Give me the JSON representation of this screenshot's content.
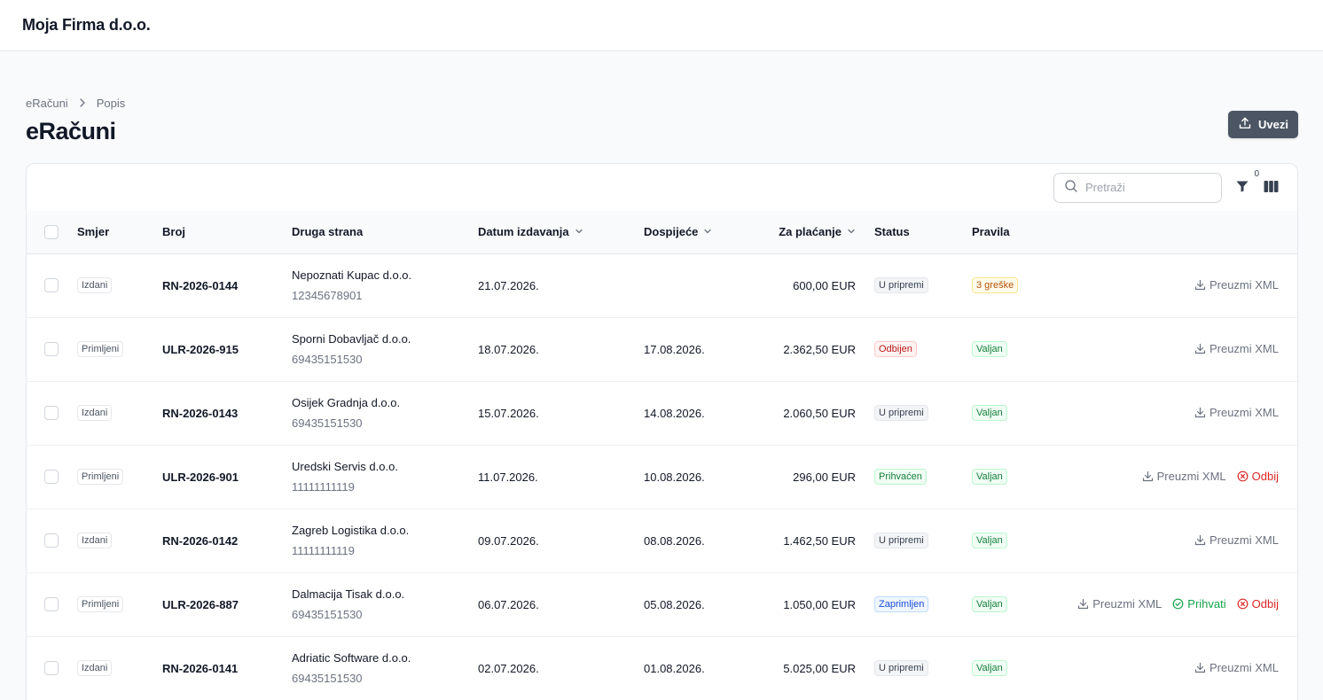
{
  "app": {
    "brand": "Moja Firma d.o.o."
  },
  "breadcrumb": {
    "root": "eRačuni",
    "current": "Popis"
  },
  "page": {
    "title": "eRačuni",
    "import_label": "Uvezi"
  },
  "toolbar": {
    "search_placeholder": "Pretraži",
    "filter_count": "0"
  },
  "table": {
    "headers": {
      "direction": "Smjer",
      "number": "Broj",
      "party": "Druga strana",
      "issue_date": "Datum izdavanja",
      "due_date": "Dospijeće",
      "amount": "Za plaćanje",
      "status": "Status",
      "rules": "Pravila"
    },
    "action_labels": {
      "download": "Preuzmi XML",
      "accept": "Prihvati",
      "reject": "Odbij"
    },
    "rows": [
      {
        "direction": "Izdani",
        "number": "RN-2026-0144",
        "party": "Nepoznati Kupac d.o.o.",
        "party_id": "12345678901",
        "issue_date": "21.07.2026.",
        "due_date": "",
        "amount": "600,00 EUR",
        "status": "U pripremi",
        "status_tone": "gray",
        "rules": "3 greške",
        "rules_tone": "amber",
        "actions": [
          "download"
        ]
      },
      {
        "direction": "Primljeni",
        "number": "ULR-2026-915",
        "party": "Sporni Dobavljač d.o.o.",
        "party_id": "69435151530",
        "issue_date": "18.07.2026.",
        "due_date": "17.08.2026.",
        "amount": "2.362,50 EUR",
        "status": "Odbijen",
        "status_tone": "red",
        "rules": "Valjan",
        "rules_tone": "green",
        "actions": [
          "download"
        ]
      },
      {
        "direction": "Izdani",
        "number": "RN-2026-0143",
        "party": "Osijek Gradnja d.o.o.",
        "party_id": "69435151530",
        "issue_date": "15.07.2026.",
        "due_date": "14.08.2026.",
        "amount": "2.060,50 EUR",
        "status": "U pripremi",
        "status_tone": "gray",
        "rules": "Valjan",
        "rules_tone": "green",
        "actions": [
          "download"
        ]
      },
      {
        "direction": "Primljeni",
        "number": "ULR-2026-901",
        "party": "Uredski Servis d.o.o.",
        "party_id": "11111111119",
        "issue_date": "11.07.2026.",
        "due_date": "10.08.2026.",
        "amount": "296,00 EUR",
        "status": "Prihvaćen",
        "status_tone": "green",
        "rules": "Valjan",
        "rules_tone": "green",
        "actions": [
          "download",
          "reject"
        ]
      },
      {
        "direction": "Izdani",
        "number": "RN-2026-0142",
        "party": "Zagreb Logistika d.o.o.",
        "party_id": "11111111119",
        "issue_date": "09.07.2026.",
        "due_date": "08.08.2026.",
        "amount": "1.462,50 EUR",
        "status": "U pripremi",
        "status_tone": "gray",
        "rules": "Valjan",
        "rules_tone": "green",
        "actions": [
          "download"
        ]
      },
      {
        "direction": "Primljeni",
        "number": "ULR-2026-887",
        "party": "Dalmacija Tisak d.o.o.",
        "party_id": "69435151530",
        "issue_date": "06.07.2026.",
        "due_date": "05.08.2026.",
        "amount": "1.050,00 EUR",
        "status": "Zaprimljen",
        "status_tone": "blue",
        "rules": "Valjan",
        "rules_tone": "green",
        "actions": [
          "download",
          "accept",
          "reject"
        ]
      },
      {
        "direction": "Izdani",
        "number": "RN-2026-0141",
        "party": "Adriatic Software d.o.o.",
        "party_id": "69435151530",
        "issue_date": "02.07.2026.",
        "due_date": "01.08.2026.",
        "amount": "5.025,00 EUR",
        "status": "U pripremi",
        "status_tone": "gray",
        "rules": "Valjan",
        "rules_tone": "green",
        "actions": [
          "download"
        ]
      }
    ]
  }
}
